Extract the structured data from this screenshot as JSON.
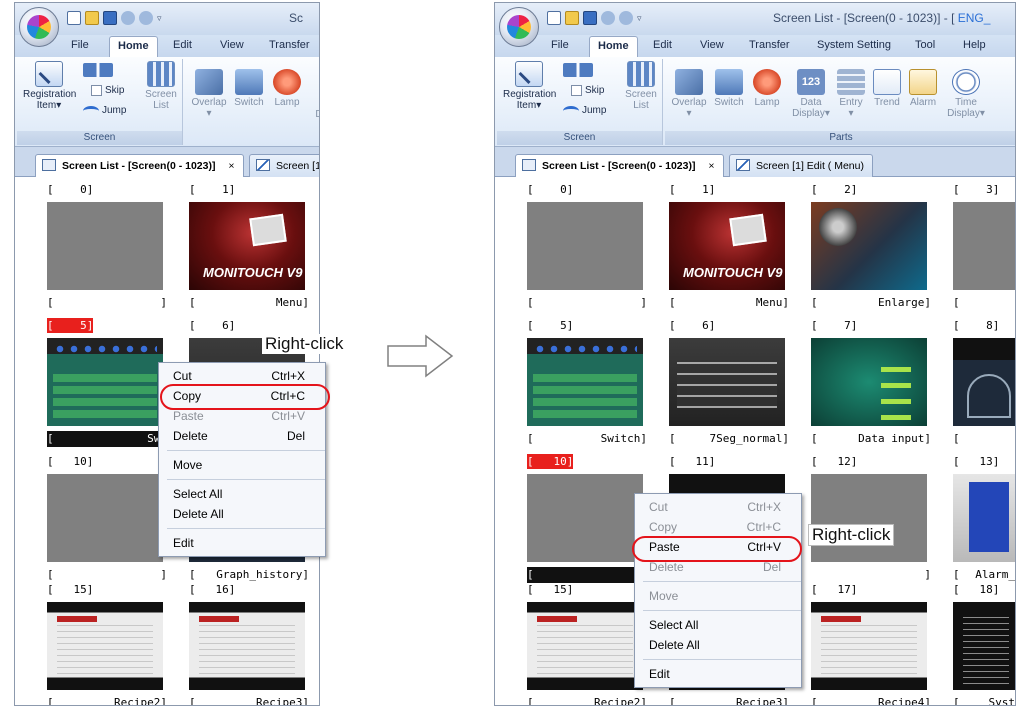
{
  "left_window": {
    "title": "Sc",
    "tabs": [
      "File",
      "Home",
      "Edit",
      "View",
      "Transfer"
    ],
    "ribbon": {
      "registration": "Registration",
      "registration_item": "Item",
      "skip": "Skip",
      "jump": "Jump",
      "screen_list_1": "Screen",
      "screen_list_2": "List",
      "overlap": "Overlap",
      "switch": "Switch",
      "lamp": "Lamp",
      "cut_d": "D",
      "group_screen": "Screen"
    },
    "doc_tab_active": "Screen List - [Screen(0 - 1023)]",
    "doc_tab_close": "×",
    "doc_tab_other": "Screen [1",
    "cells": [
      {
        "num": "[    0]",
        "name_l": "[",
        "name": "",
        "name_r": "]"
      },
      {
        "num": "[    1]",
        "name_l": "[",
        "name": "Menu",
        "name_r": "]"
      },
      {
        "num": "[    5]",
        "name_l": "[",
        "name": "Swi",
        "name_r": ""
      },
      {
        "num": "[    6]",
        "name_l": "[",
        "name": "",
        "name_r": ""
      },
      {
        "num": "[   10]",
        "name_l": "[",
        "name": "",
        "name_r": "]"
      },
      {
        "num": "",
        "name_l": "[",
        "name": "Graph_history",
        "name_r": "]"
      },
      {
        "num": "[   15]",
        "name_l": "[",
        "name": "Recipe2",
        "name_r": "]"
      },
      {
        "num": "[   16]",
        "name_l": "[",
        "name": "Recipe3",
        "name_r": "]"
      }
    ],
    "v9_text": "MONITOUCH V9",
    "right_click_label": "Right-click",
    "menu": [
      {
        "label": "Cut",
        "shortcut": "Ctrl+X",
        "disabled": false
      },
      {
        "label": "Copy",
        "shortcut": "Ctrl+C",
        "disabled": false
      },
      {
        "label": "Paste",
        "shortcut": "Ctrl+V",
        "disabled": true
      },
      {
        "label": "Delete",
        "shortcut": "Del",
        "disabled": false
      },
      {
        "label": "Move",
        "shortcut": "",
        "disabled": false
      },
      {
        "label": "Select All",
        "shortcut": "",
        "disabled": false
      },
      {
        "label": "Delete All",
        "shortcut": "",
        "disabled": false
      },
      {
        "label": "Edit",
        "shortcut": "",
        "disabled": false
      }
    ]
  },
  "right_window": {
    "title_prefix": "Screen List - [Screen(0 - 1023)] - [",
    "title_accent": " ENG_",
    "tabs": [
      "File",
      "Home",
      "Edit",
      "View",
      "Transfer",
      "System Setting",
      "Tool",
      "Help"
    ],
    "ribbon": {
      "registration": "Registration",
      "registration_item": "Item",
      "skip": "Skip",
      "jump": "Jump",
      "screen_list_1": "Screen",
      "screen_list_2": "List",
      "group_screen": "Screen",
      "overlap": "Overlap",
      "switch": "Switch",
      "lamp": "Lamp",
      "data_display_1": "Data",
      "data_display_2": "Display",
      "data_display_icon": "123",
      "entry": "Entry",
      "trend": "Trend",
      "alarm": "Alarm",
      "time_display_1": "Time",
      "time_display_2": "Display",
      "group_parts": "Parts"
    },
    "doc_tab_active": "Screen List - [Screen(0 - 1023)]",
    "doc_tab_close": "×",
    "doc_tab_other": "Screen [1] Edit (      Menu)",
    "cells": [
      {
        "num": "[    0]",
        "name_l": "[",
        "name": "",
        "name_r": "]"
      },
      {
        "num": "[    1]",
        "name_l": "[",
        "name": "Menu",
        "name_r": "]"
      },
      {
        "num": "[    2]",
        "name_l": "[",
        "name": "Enlarge",
        "name_r": "]"
      },
      {
        "num": "[    3]",
        "name_l": "[",
        "name": "",
        "name_r": ""
      },
      {
        "num": "[    5]",
        "name_l": "[",
        "name": "Switch",
        "name_r": "]"
      },
      {
        "num": "[    6]",
        "name_l": "[",
        "name": "7Seg_normal",
        "name_r": "]"
      },
      {
        "num": "[    7]",
        "name_l": "[",
        "name": "Data input",
        "name_r": "]"
      },
      {
        "num": "[    8]",
        "name_l": "[",
        "name": "",
        "name_r": ""
      },
      {
        "num": "[   10]",
        "name_l": "[",
        "name": "",
        "name_r": ""
      },
      {
        "num": "[   11]",
        "name_l": "",
        "name": "",
        "name_r": ""
      },
      {
        "num": "[   12]",
        "name_l": "",
        "name": "",
        "name_r": "]"
      },
      {
        "num": "[   13]",
        "name_l": "[",
        "name": "Alarm_",
        "name_r": ""
      },
      {
        "num": "[   15]",
        "name_l": "[",
        "name": "Recipe2",
        "name_r": "]"
      },
      {
        "num": "",
        "name_l": "[",
        "name": "Recipe3",
        "name_r": "]"
      },
      {
        "num": "[   17]",
        "name_l": "[",
        "name": "Recipe4",
        "name_r": "]"
      },
      {
        "num": "[   18]",
        "name_l": "[",
        "name": "Syst",
        "name_r": ""
      }
    ],
    "v9_text": "MONITOUCH V9",
    "right_click_label": "Right-click",
    "menu": [
      {
        "label": "Cut",
        "shortcut": "Ctrl+X",
        "disabled": true
      },
      {
        "label": "Copy",
        "shortcut": "Ctrl+C",
        "disabled": true
      },
      {
        "label": "Paste",
        "shortcut": "Ctrl+V",
        "disabled": false
      },
      {
        "label": "Delete",
        "shortcut": "Del",
        "disabled": true
      },
      {
        "label": "Move",
        "shortcut": "",
        "disabled": true
      },
      {
        "label": "Select All",
        "shortcut": "",
        "disabled": false
      },
      {
        "label": "Delete All",
        "shortcut": "",
        "disabled": false
      },
      {
        "label": "Edit",
        "shortcut": "",
        "disabled": false
      }
    ]
  },
  "colors": {
    "selection_red": "#e8201d",
    "highlight_ring": "#e4141b",
    "ribbon_blue": "#c6d7ee"
  },
  "icons": [
    "app-orb-icon",
    "new-file-icon",
    "open-folder-icon",
    "save-icon",
    "undo-icon",
    "redo-icon",
    "registration-icon",
    "skip-jump-arrows-icon",
    "screen-list-icon",
    "overlap-icon",
    "switch-icon",
    "lamp-icon",
    "data-display-icon",
    "entry-icon",
    "trend-icon",
    "alarm-icon",
    "time-display-icon",
    "transition-arrow-icon"
  ]
}
